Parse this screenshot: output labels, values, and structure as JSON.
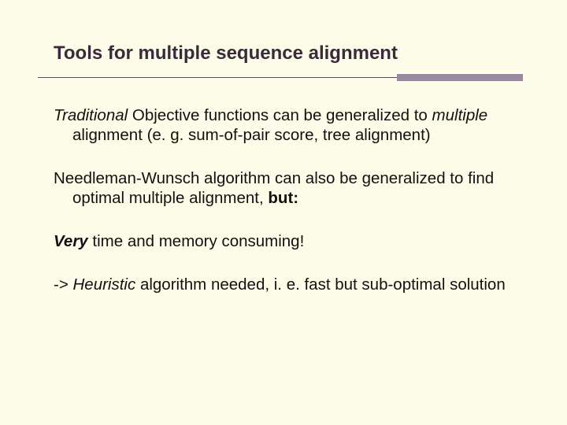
{
  "title": "Tools for multiple sequence alignment",
  "p1": {
    "a": "Traditional",
    "b": " Objective functions can be generalized to ",
    "c": "multiple",
    "d": " alignment (e. g. sum-of-pair score, tree alignment)"
  },
  "p2": {
    "a": "Needleman-Wunsch algorithm can also be generalized to find optimal multiple alignment, ",
    "b": "but:"
  },
  "p3": {
    "a": "Very",
    "b": " time and memory consuming!"
  },
  "p4": {
    "a": " -> ",
    "b": "Heuristic",
    "c": " algorithm needed, i. e. fast but sub-optimal solution"
  }
}
